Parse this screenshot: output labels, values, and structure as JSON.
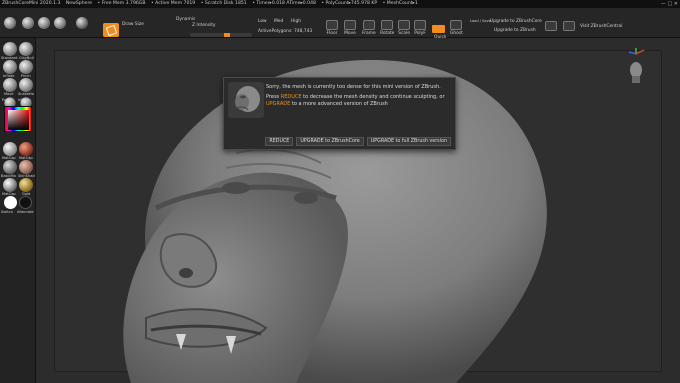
{
  "titlebar": {
    "items": [
      "ZBrushCoreMini 2020.1.3",
      "NewSphere",
      "• Free Mem 3.796GB",
      "• Active Mem 7019",
      "• Scratch Disk 1851",
      "• Timer▸0.018 ATime▸0.048",
      "• PolyCount▸745.978 KP",
      "• MeshCount▸1"
    ],
    "window_controls": "— □ ✕"
  },
  "toolbar": {
    "draw_size_label": "Draw Size",
    "dynamic_label": "Dynamic",
    "z_intensity_label": "Z Intensity",
    "low_label": "Low",
    "med_label": "Med",
    "high_label": "High",
    "active_points": "ActivePolygons: 748,743",
    "icons": [
      {
        "label": "Floor"
      },
      {
        "label": "Move"
      },
      {
        "label": "Frame"
      },
      {
        "label": "Rotate"
      },
      {
        "label": "Scale"
      },
      {
        "label": "PolyF"
      },
      {
        "label": "Quick"
      },
      {
        "label": "Ghost"
      }
    ],
    "load_save": "Load / Save",
    "upgrade_core": "Upgrade to ZBrushCore",
    "upgrade_zbrush": "Upgrade to ZBrush",
    "visit_central": "Visit ZBrushCentral"
  },
  "coords": "0.3123,0.07,-0.0334",
  "leftbar": {
    "brushes": [
      "Standard",
      "ClayBuil",
      "Inflate",
      "Pinch",
      "Move",
      "SnakeHo",
      "Polish",
      "hPolish"
    ],
    "materials": [
      "MatCap",
      "MatCap",
      "BasicMa",
      "SkinShad",
      "MatCap",
      "Gold"
    ],
    "swatch_labels": [
      "Switch",
      "Alternate"
    ]
  },
  "dialog": {
    "line1": "Sorry, the mesh is currently too dense for this mini version of ZBrush.",
    "line2_pre": "Press ",
    "line2_accent": "REDUCE",
    "line2_post": " to decrease the mesh density and continue sculpting, or",
    "line3_accent": "UPGRADE",
    "line3_post": " to a more advanced version of ZBrush",
    "buttons": [
      "REDUCE",
      "UPGRADE to ZBrushCore",
      "UPGRADE to full ZBrush version"
    ]
  },
  "colors": {
    "accent": "#f28c1e",
    "background": "#2c2c2c",
    "mesh": "#8c8c8c"
  }
}
